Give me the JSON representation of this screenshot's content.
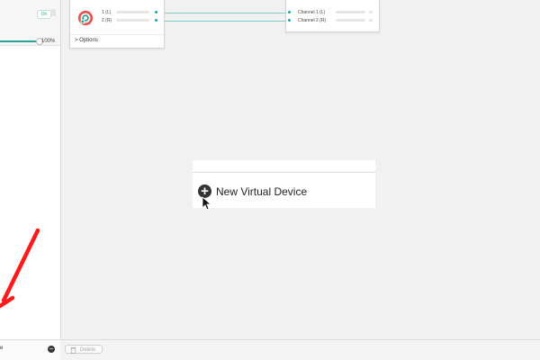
{
  "sidebar": {
    "toggle_label": "On",
    "volume_value": "100%",
    "volume_level": 1.0,
    "bottom_label": "e",
    "remove_icon": "minus-circle-icon"
  },
  "device_card": {
    "channels": [
      "1 (L)",
      "2 (R)"
    ],
    "options_label": "> Options",
    "logo_icon": "loopback-logo-icon"
  },
  "output_card": {
    "channels": [
      "Channel 1 (L)",
      "Channel 2 (R)"
    ]
  },
  "menu": {
    "item_label": "New Virtual Device",
    "item_icon": "plus-circle-icon"
  },
  "footer": {
    "delete_label": "Delete",
    "delete_icon": "trash-icon"
  },
  "colors": {
    "accent": "#2aa396",
    "annotation_arrow": "#ff1a1a"
  }
}
